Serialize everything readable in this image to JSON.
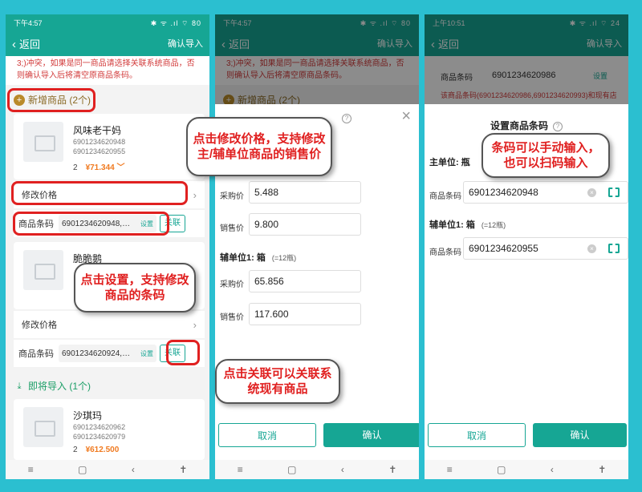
{
  "p1": {
    "status": {
      "time": "下午4:57",
      "icons": "✱ ᯤ .ıl ⌔ 80"
    },
    "nav": {
      "back": "返回",
      "confirm": "确认导入"
    },
    "warning": "3;)冲突，如果是同一商品请选择关联系统商品，否则确认导入后将清空原商品条码。",
    "new_section": "新增商品 (2个)",
    "product1": {
      "name": "风味老干妈",
      "code1": "6901234620948",
      "code2": "6901234620955",
      "qty": "2",
      "price": "¥71.344 ﹀"
    },
    "edit_price": "修改价格",
    "barcode_label": "商品条码",
    "barcode1": "6901234620948,…",
    "set": "设置",
    "link": "关联",
    "product2": {
      "name": "脆脆鹅"
    },
    "barcode2": "6901234620924,…",
    "import_section": "即将导入 (1个)",
    "product3": {
      "name": "沙琪玛",
      "code1": "6901234620962",
      "code2": "6901234620979",
      "qty": "2",
      "price": "¥612.500"
    }
  },
  "p2": {
    "status": {
      "time": "下午4:57"
    },
    "nav": {
      "back": "返回",
      "confirm": "确认导入"
    },
    "warning": "3;)冲突，如果是同一商品请选择关联系统商品，否则确认导入后将清空原商品条码。",
    "new_section": "新增商品 (2个)",
    "purchase": "采购价",
    "sale": "销售价",
    "main_purchase": "5.488",
    "main_sale": "9.800",
    "aux_unit": "辅单位1:  箱",
    "aux_note": "(=12瓶)",
    "aux_purchase": "65.856",
    "aux_sale": "117.600",
    "cancel": "取消",
    "ok": "确认"
  },
  "p3": {
    "status": {
      "time": "上午10:51",
      "icons": "✱ ᯤ .ıl ⌔ 24"
    },
    "nav": {
      "back": "返回",
      "confirm": "确认导入"
    },
    "bg_label": "商品条码",
    "bg_value": "6901234620986",
    "bg_set": "设置",
    "bg_warn": "该商品条码(6901234620986,6901234620993)和现有店",
    "title": "设置商品条码",
    "main_unit": "主单位: 瓶",
    "barcode_label": "商品条码",
    "main_code": "6901234620948",
    "aux_unit": "辅单位1:  箱",
    "aux_note": "(=12瓶)",
    "aux_code": "6901234620955",
    "cancel": "取消",
    "ok": "确认"
  },
  "callouts": {
    "edit_price": "点击修改价格，支持修改主/辅单位商品的销售价",
    "set_barcode": "点击设置，支持修改商品的条码",
    "link_product": "点击关联可以关联系统现有商品",
    "barcode_input": "条码可以手动输入，也可以扫码输入"
  },
  "navbar": {
    "menu": "≡",
    "home": "▢",
    "back": "‹",
    "access": "✝"
  },
  "colors": {
    "teal": "#16a694",
    "background": "#2bbfd0",
    "highlight": "#e02020"
  }
}
